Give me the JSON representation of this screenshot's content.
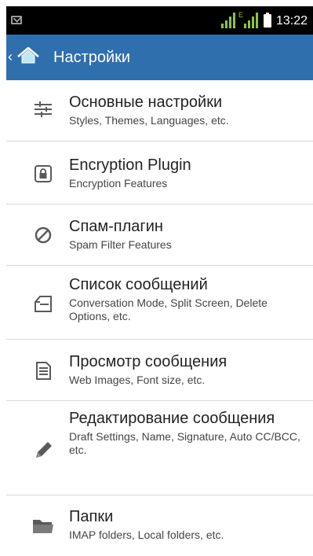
{
  "status_bar": {
    "time": "13:22",
    "network_label": "E",
    "icons": [
      "mail-notification-icon",
      "signal-icon",
      "signal-icon",
      "battery-icon"
    ]
  },
  "action_bar": {
    "title": "Настройки",
    "back_glyph": "‹",
    "icon": "home-icon"
  },
  "settings": {
    "items": [
      {
        "icon": "sliders-icon",
        "title": "Основные настройки",
        "subtitle": "Styles, Themes, Languages, etc."
      },
      {
        "icon": "lock-icon",
        "title": "Encryption Plugin",
        "subtitle": "Encryption Features"
      },
      {
        "icon": "block-icon",
        "title": "Спам-плагин",
        "subtitle": "Spam Filter Features"
      },
      {
        "icon": "message-list-icon",
        "title": "Список сообщений",
        "subtitle": "Conversation Mode, Split Screen, Delete Options, etc."
      },
      {
        "icon": "document-icon",
        "title": "Просмотр сообщения",
        "subtitle": "Web Images, Font size, etc."
      },
      {
        "icon": "pencil-icon",
        "title": "Редактирование сообщения",
        "subtitle": "Draft Settings, Name, Signature, Auto CC/BCC, etc."
      },
      {
        "icon": "folder-icon",
        "title": "Папки",
        "subtitle": "IMAP folders, Local folders, etc."
      }
    ]
  },
  "colors": {
    "action_bar": "#2f6fae",
    "status_bar": "#000000",
    "signal": "#8bc53f",
    "icon": "#5a5a5a",
    "divider": "#d9d9d9"
  }
}
